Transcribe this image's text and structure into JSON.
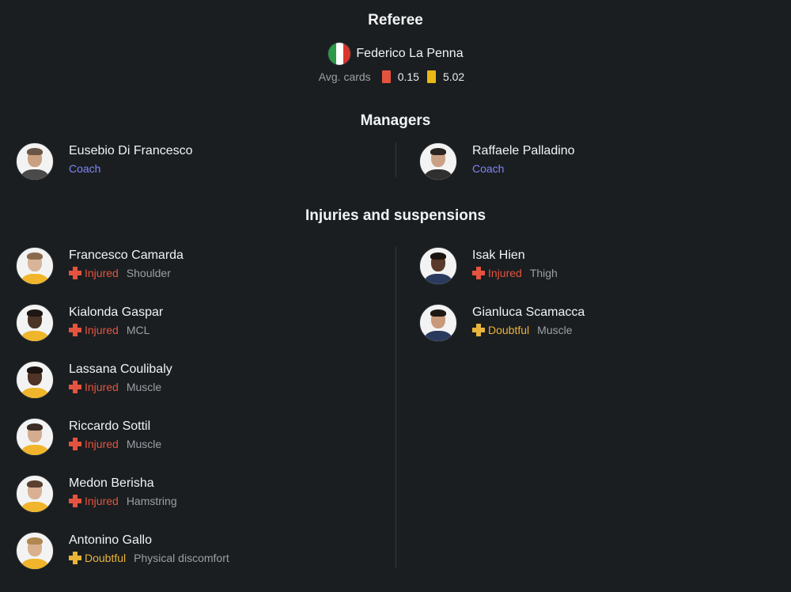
{
  "referee": {
    "title": "Referee",
    "name": "Federico La Penna",
    "flag_colors": [
      "#2a9a48",
      "#ffffff",
      "#d9352b"
    ],
    "avg_cards_label": "Avg. cards",
    "red_avg": "0.15",
    "yellow_avg": "5.02",
    "red_color": "#e5533f",
    "yellow_color": "#e8b817"
  },
  "managers": {
    "title": "Managers",
    "home": {
      "name": "Eusebio Di Francesco",
      "role": "Coach"
    },
    "away": {
      "name": "Raffaele Palladino",
      "role": "Coach"
    }
  },
  "injuries": {
    "title": "Injuries and suspensions",
    "home": [
      {
        "name": "Francesco Camarda",
        "status": "Injured",
        "reason": "Shoulder"
      },
      {
        "name": "Kialonda Gaspar",
        "status": "Injured",
        "reason": "MCL"
      },
      {
        "name": "Lassana Coulibaly",
        "status": "Injured",
        "reason": "Muscle"
      },
      {
        "name": "Riccardo Sottil",
        "status": "Injured",
        "reason": "Muscle"
      },
      {
        "name": "Medon Berisha",
        "status": "Injured",
        "reason": "Hamstring"
      },
      {
        "name": "Antonino Gallo",
        "status": "Doubtful",
        "reason": "Physical discomfort"
      }
    ],
    "away": [
      {
        "name": "Isak Hien",
        "status": "Injured",
        "reason": "Thigh"
      },
      {
        "name": "Gianluca Scamacca",
        "status": "Doubtful",
        "reason": "Muscle"
      }
    ]
  },
  "colors": {
    "coach": "#7f85f5",
    "injured": "#e5533f",
    "doubtful": "#e8b43a",
    "home_shirt": "#f0b52a",
    "away_shirt": "#2a3a5e"
  }
}
